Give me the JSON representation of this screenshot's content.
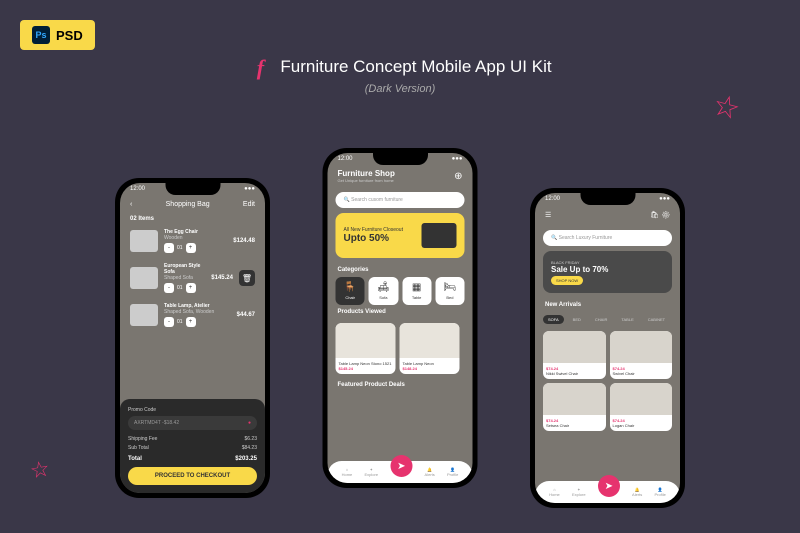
{
  "badge": "PSD",
  "title": "Furniture Concept Mobile App UI Kit",
  "subtitle": "(Dark Version)",
  "time": "12:00",
  "screen1": {
    "header": "Shopping Bag",
    "edit": "Edit",
    "count": "02 Items",
    "items": [
      {
        "name": "The Egg Chair",
        "sub": "Wooden",
        "price": "$124.48",
        "qty": "01"
      },
      {
        "name": "European Style Sofa",
        "sub": "Shaped Sofa",
        "price": "$145.24",
        "qty": "01"
      },
      {
        "name": "Table Lamp, Atelier",
        "sub": "Shaped Sofa, Wooden",
        "price": "$44.67",
        "qty": "01"
      }
    ],
    "promo_label": "Promo Code",
    "promo_code": "AXRTMD4T -$18.42",
    "shipping_label": "Shipping Fee",
    "shipping": "$6.23",
    "subtotal_label": "Sub Total",
    "subtotal": "$84.23",
    "total_label": "Total",
    "total": "$203.25",
    "checkout": "PROCEED TO CHECKOUT"
  },
  "screen2": {
    "shop_title": "Furniture Shop",
    "shop_sub": "Get Unique furniture from home",
    "search": "Search cusom furniture",
    "promo_sub": "All New Furniture Closeout",
    "promo_big": "Upto 50%",
    "cat_title": "Categories",
    "cats": [
      "Chair",
      "Sofa",
      "Table",
      "Bed"
    ],
    "viewed_title": "Products Viewed",
    "products": [
      {
        "name": "Table Lamp Neon Stono 1521",
        "price": "$145.24"
      },
      {
        "name": "Table Lamp Neon",
        "price": "$148.24"
      }
    ],
    "featured": "Featured Product Deals",
    "nav": [
      "Home",
      "Explore",
      "Alerts",
      "Profile"
    ]
  },
  "screen3": {
    "search": "Search Luxury Furniture",
    "banner_tag": "BLACK FRIDAY",
    "banner_big": "Sale Up to 70%",
    "banner_btn": "SHOP NOW",
    "arrivals": "New Arrivals",
    "tabs": [
      "SOFA",
      "BED",
      "CHAIR",
      "TABLE",
      "CABINET"
    ],
    "items": [
      {
        "name": "Nikki Swivel Chair",
        "price": "$74.24"
      },
      {
        "name": "Swivel Chair",
        "price": "$74.24"
      },
      {
        "name": "Setsea Chair",
        "price": "$74.24"
      },
      {
        "name": "Logan Chair",
        "price": "$74.24"
      }
    ],
    "nav": [
      "Home",
      "Explore",
      "Alerts",
      "Profile"
    ]
  }
}
